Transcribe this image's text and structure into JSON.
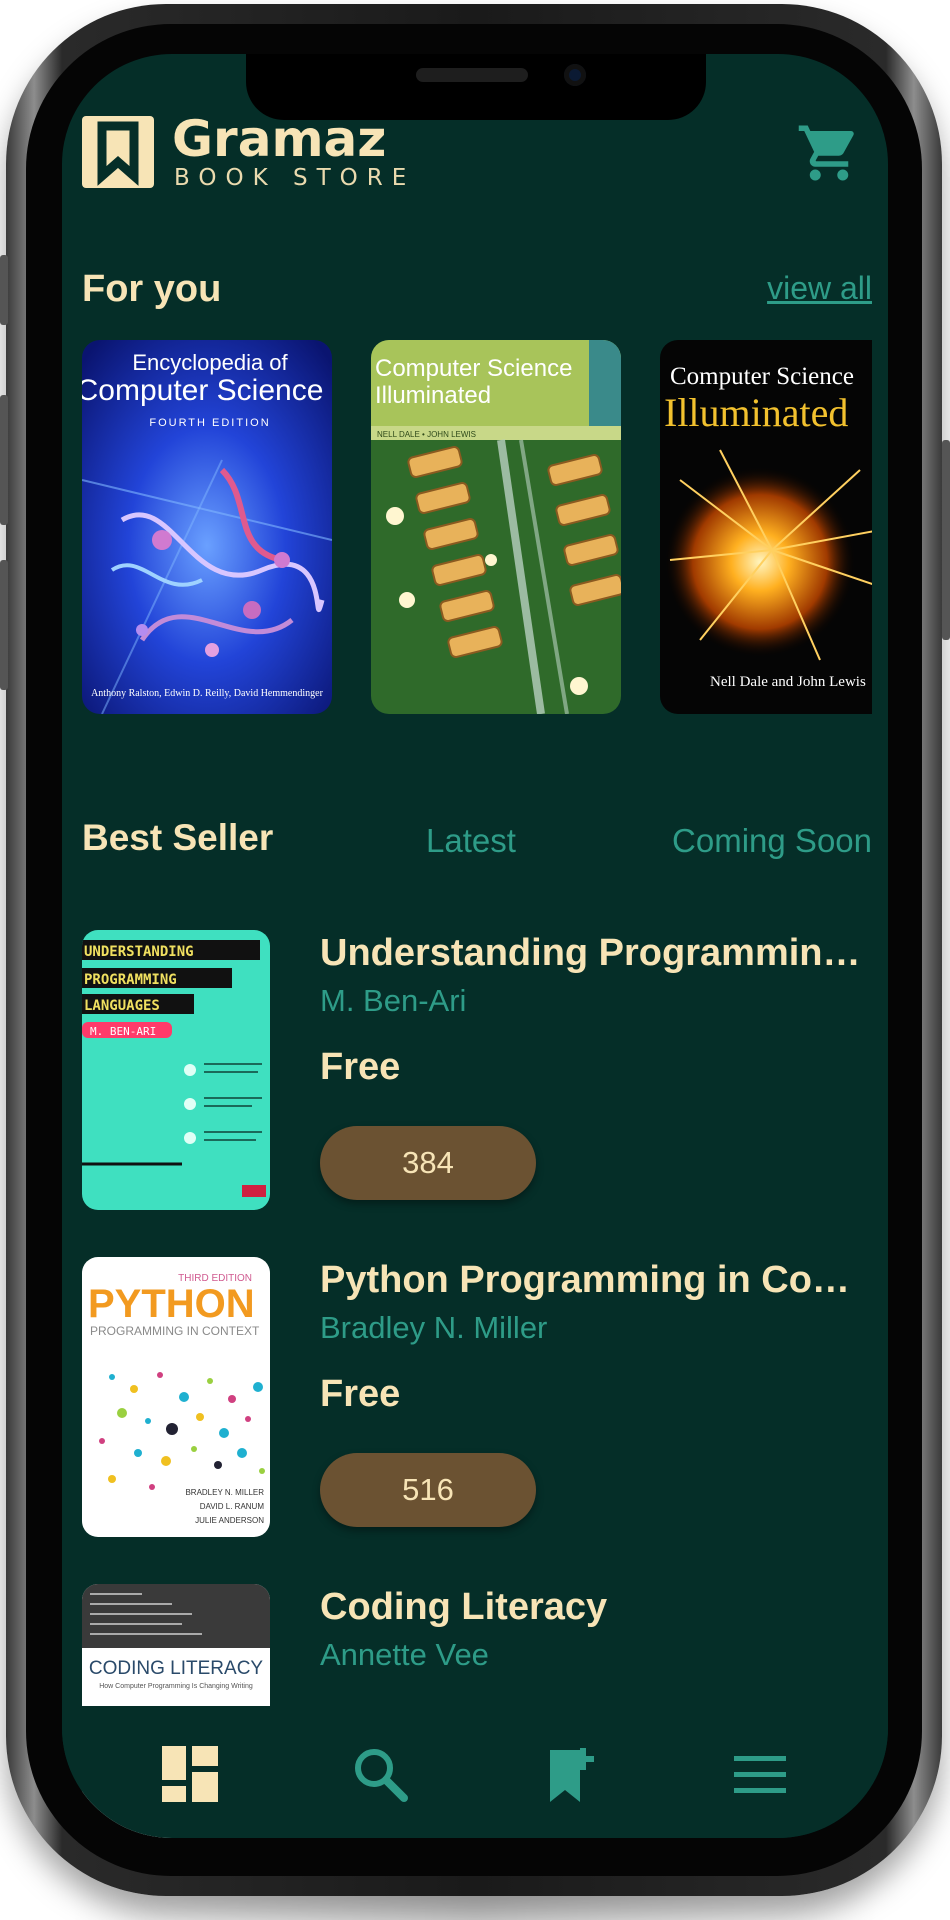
{
  "app": {
    "brand_name": "Gramaz",
    "brand_sub": "BOOK STORE"
  },
  "icons": {
    "logo": "bookmark-logo-icon",
    "cart": "shopping-cart-icon",
    "nav": [
      "dashboard-icon",
      "search-icon",
      "bookmark-add-icon",
      "menu-icon"
    ]
  },
  "colors": {
    "background": "#052e28",
    "cream": "#f7e4b6",
    "teal": "#2e9c88",
    "pill": "#6b5232"
  },
  "for_you": {
    "title": "For you",
    "view_all": "view all",
    "covers": [
      {
        "title_line1": "Encyclopedia of",
        "title_line2": "Computer Science",
        "edition": "FOURTH EDITION",
        "authors": "Anthony Ralston, Edwin D. Reilly, David Hemmendinger"
      },
      {
        "title_line1": "Computer Science",
        "title_line2": "Illuminated",
        "authors": "NELL DALE • JOHN LEWIS"
      },
      {
        "title_line1": "Computer Science",
        "title_line2": "Illuminated",
        "authors": "Nell Dale and John Lewis"
      }
    ]
  },
  "tabs": [
    {
      "label": "Best Seller",
      "active": true
    },
    {
      "label": "Latest",
      "active": false
    },
    {
      "label": "Coming Soon",
      "active": false
    }
  ],
  "books": [
    {
      "title": "Understanding Programmin…",
      "author": "M. Ben-Ari",
      "price": "Free",
      "count": "384",
      "cover_lines": [
        "UNDERSTANDING",
        "PROGRAMMING",
        "LANGUAGES",
        "M. BEN-ARI"
      ]
    },
    {
      "title": "Python Programming in Con…",
      "author": "Bradley N. Miller",
      "price": "Free",
      "count": "516",
      "cover_lines": [
        "THIRD EDITION",
        "PYTHON",
        "PROGRAMMING IN CONTEXT",
        "BRADLEY N. MILLER",
        "DAVID L. RANUM",
        "JULIE ANDERSON"
      ]
    },
    {
      "title": "Coding Literacy",
      "author": "Annette Vee",
      "price": "",
      "count": "",
      "cover_lines": [
        "CODING LITERACY",
        "How Computer Programming Is Changing Writing"
      ]
    }
  ]
}
